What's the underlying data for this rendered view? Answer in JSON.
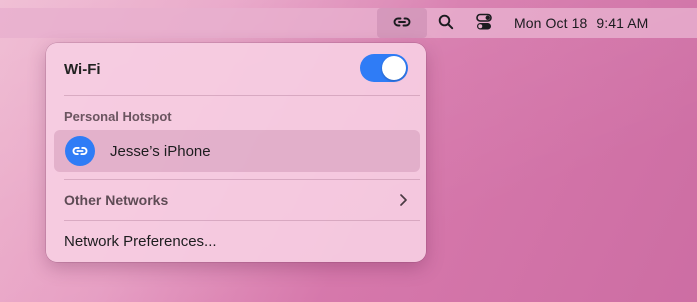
{
  "menubar": {
    "hotspot_icon": "link-chain-icon",
    "search_icon": "search-icon",
    "control_center_icon": "control-center-icon",
    "date": "Mon Oct 18",
    "time": "9:41 AM"
  },
  "wifi_menu": {
    "wifi_label": "Wi-Fi",
    "wifi_enabled": true,
    "personal_hotspot_header": "Personal Hotspot",
    "hotspot_device": "Jesse’s iPhone",
    "hotspot_device_icon": "link-chain-icon",
    "other_networks_label": "Other Networks",
    "other_networks_chevron": "chevron-right-icon",
    "network_preferences_label": "Network Preferences..."
  },
  "colors": {
    "accent": "#2f7cf6",
    "panel_bg": "#f6cee2",
    "menubar_bg": "#e8b0ce",
    "desktop": "#d889b8"
  }
}
